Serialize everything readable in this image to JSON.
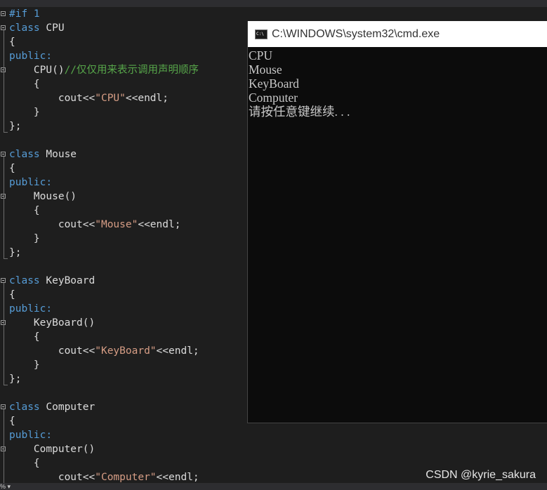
{
  "code": {
    "directive": "#if 1",
    "classes": [
      {
        "keyword": "class",
        "name": "CPU",
        "open_brace": "{",
        "access": "public:",
        "ctor": "CPU()",
        "comment": "//仅仅用来表示调用声明顺序",
        "body_open": "{",
        "stmt_a": "cout<<",
        "literal": "\"CPU\"",
        "stmt_b": "<<endl;",
        "body_close": "}",
        "close": "};"
      },
      {
        "keyword": "class",
        "name": "Mouse",
        "open_brace": "{",
        "access": "public:",
        "ctor": "Mouse()",
        "body_open": "{",
        "stmt_a": "cout<<",
        "literal": "\"Mouse\"",
        "stmt_b": "<<endl;",
        "body_close": "}",
        "close": "};"
      },
      {
        "keyword": "class",
        "name": "KeyBoard",
        "open_brace": "{",
        "access": "public:",
        "ctor": "KeyBoard()",
        "body_open": "{",
        "stmt_a": "cout<<",
        "literal": "\"KeyBoard\"",
        "stmt_b": "<<endl;",
        "body_close": "}",
        "close": "};"
      },
      {
        "keyword": "class",
        "name": "Computer",
        "open_brace": "{",
        "access": "public:",
        "ctor": "Computer()",
        "body_open": "{",
        "stmt_a": "cout<<",
        "literal": "\"Computer\"",
        "stmt_b": "<<endl;"
      }
    ]
  },
  "console": {
    "icon": "console-app-icon",
    "icon_glyph": "C:\\",
    "title": "C:\\WINDOWS\\system32\\cmd.exe",
    "lines": [
      "CPU",
      "Mouse",
      "KeyBoard",
      "Computer",
      "请按任意键继续. . ."
    ]
  },
  "status": {
    "zoom_glyph": "% ▾"
  },
  "watermark": "CSDN @kyrie_sakura",
  "colors": {
    "editor_bg": "#1e1e1e",
    "keyword": "#569cd6",
    "comment": "#57a64a",
    "string": "#d69d85",
    "console_bg": "#0c0c0c",
    "console_text": "#c8c8c8"
  }
}
